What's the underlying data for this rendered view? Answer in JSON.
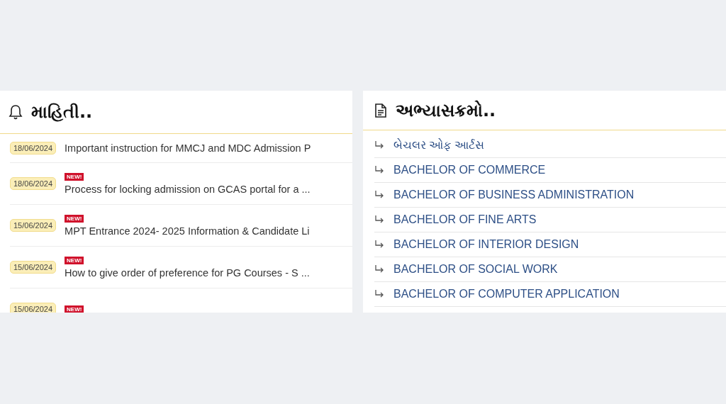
{
  "notices": {
    "title": "માહિતી..",
    "items": [
      {
        "date": "18/06/2024",
        "title": "Important instruction for MMCJ and MDC Admission P"
      },
      {
        "date": "18/06/2024",
        "badge": "NEW!",
        "title": "Process for locking admission on GCAS portal for a ..."
      },
      {
        "date": "15/06/2024",
        "badge": "NEW!",
        "title": "MPT Entrance 2024- 2025 Information & Candidate Li"
      },
      {
        "date": "15/06/2024",
        "badge": "NEW!",
        "title": "How to give order of preference for PG Courses - S ..."
      },
      {
        "date": "15/06/2024",
        "badge": "NEW!"
      }
    ]
  },
  "courses": {
    "title": "અભ્યાસક્રમો..",
    "items": [
      "બેચલર ઓફ આર્ટસ",
      "BACHELOR OF COMMERCE",
      "BACHELOR OF BUSINESS ADMINISTRATION",
      "BACHELOR OF FINE ARTS",
      "BACHELOR OF INTERIOR DESIGN",
      "BACHELOR OF SOCIAL WORK",
      "BACHELOR OF COMPUTER APPLICATION"
    ]
  }
}
